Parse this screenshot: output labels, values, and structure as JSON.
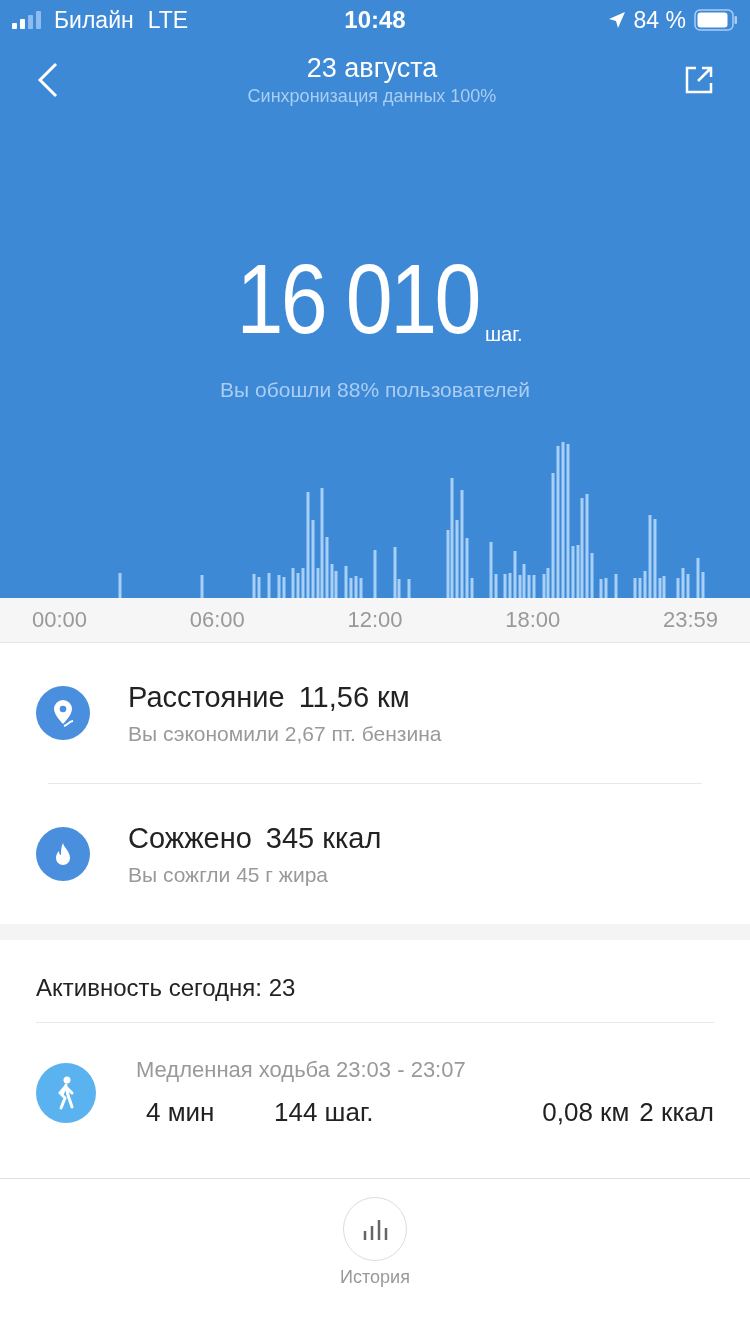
{
  "status_bar": {
    "carrier": "Билайн",
    "network": "LTE",
    "time": "10:48",
    "battery": "84 %"
  },
  "header": {
    "title": "23 августа",
    "subtitle": "Синхронизация данных 100%"
  },
  "steps": {
    "value": "16 010",
    "unit": "шаг.",
    "caption": "Вы обошли 88% пользователей"
  },
  "time_axis": [
    "00:00",
    "06:00",
    "12:00",
    "18:00",
    "23:59"
  ],
  "stats": [
    {
      "kind": "distance",
      "title": "Расстояние",
      "value": "11,56 км",
      "note": "Вы сэкономили 2,67 пт. бензина"
    },
    {
      "kind": "calories",
      "title": "Сожжено",
      "value": "345 ккал",
      "note": "Вы сожгли 45 г жира"
    }
  ],
  "activity": {
    "heading": "Активность сегодня: 23",
    "items": [
      {
        "kind": "walk",
        "title": "Медленная ходьба 23:03 - 23:07",
        "duration": "4 мин",
        "steps": "144 шаг.",
        "distance": "0,08 км",
        "calories": "2 ккал"
      }
    ]
  },
  "bottom_nav": {
    "label": "История"
  }
}
